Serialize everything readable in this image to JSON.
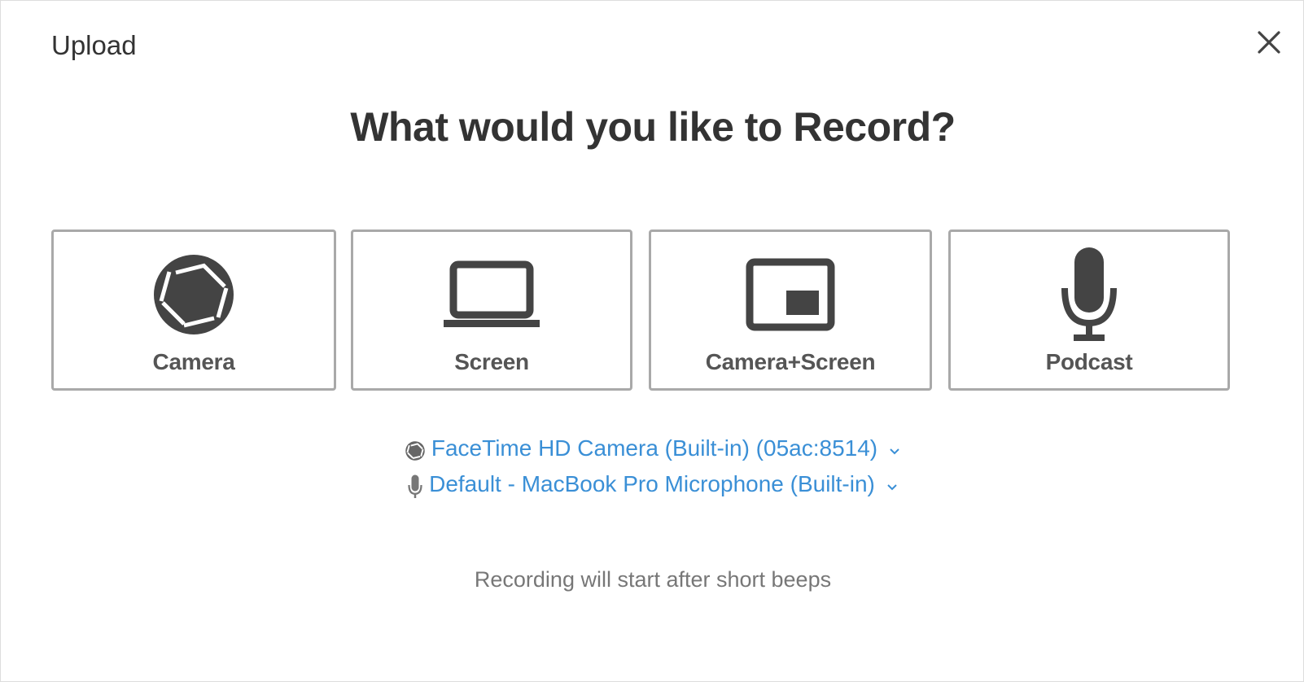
{
  "dialog": {
    "title": "Upload",
    "close_icon": "close-icon"
  },
  "heading": "What would you like to Record?",
  "options": [
    {
      "label": "Camera",
      "icon": "camera-shutter-icon"
    },
    {
      "label": "Screen",
      "icon": "laptop-icon"
    },
    {
      "label": "Camera+Screen",
      "icon": "picture-in-picture-icon"
    },
    {
      "label": "Podcast",
      "icon": "microphone-icon"
    }
  ],
  "devices": {
    "camera": {
      "label": "FaceTime HD Camera (Built-in) (05ac:8514)",
      "icon": "camera-shutter-icon"
    },
    "microphone": {
      "label": "Default - MacBook Pro Microphone (Built-in)",
      "icon": "microphone-icon"
    }
  },
  "hint": "Recording will start after short beeps",
  "colors": {
    "text": "#333333",
    "option_border": "#a9a9a9",
    "icon": "#444444",
    "link": "#3a8fd6",
    "hint": "#777777"
  }
}
